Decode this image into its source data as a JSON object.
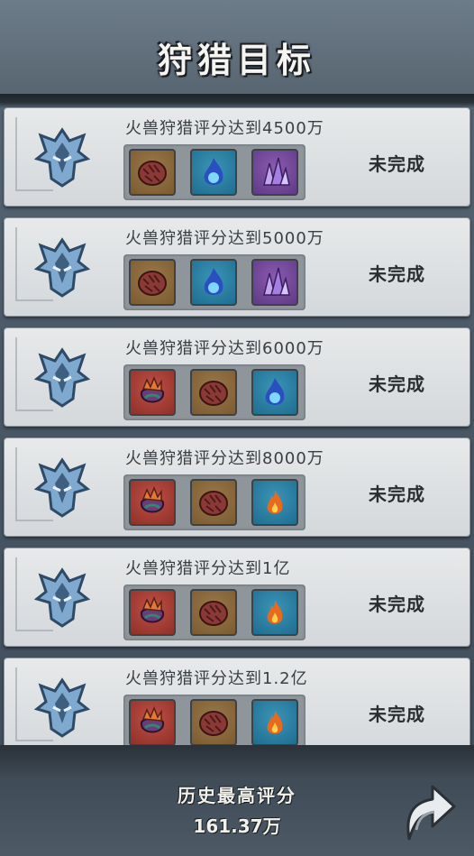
{
  "header": {
    "title": "狩猎目标"
  },
  "goals": [
    {
      "label": "火兽狩猎评分达到4500万",
      "status": "未完成",
      "rewards": [
        "meat-icon",
        "blue-flame-icon",
        "crystal-icon"
      ]
    },
    {
      "label": "火兽狩猎评分达到5000万",
      "status": "未完成",
      "rewards": [
        "meat-icon",
        "blue-flame-icon",
        "crystal-icon"
      ]
    },
    {
      "label": "火兽狩猎评分达到6000万",
      "status": "未完成",
      "rewards": [
        "treasure-bag-icon",
        "meat-icon",
        "blue-flame-icon"
      ]
    },
    {
      "label": "火兽狩猎评分达到8000万",
      "status": "未完成",
      "rewards": [
        "treasure-bag-icon",
        "meat-icon",
        "fire-icon"
      ]
    },
    {
      "label": "火兽狩猎评分达到1亿",
      "status": "未完成",
      "rewards": [
        "treasure-bag-icon",
        "meat-icon",
        "fire-icon"
      ]
    },
    {
      "label": "火兽狩猎评分达到1.2亿",
      "status": "未完成",
      "rewards": [
        "treasure-bag-icon",
        "meat-icon",
        "fire-icon"
      ]
    }
  ],
  "footer": {
    "best_label": "历史最高评分",
    "best_value": "161.37万"
  }
}
